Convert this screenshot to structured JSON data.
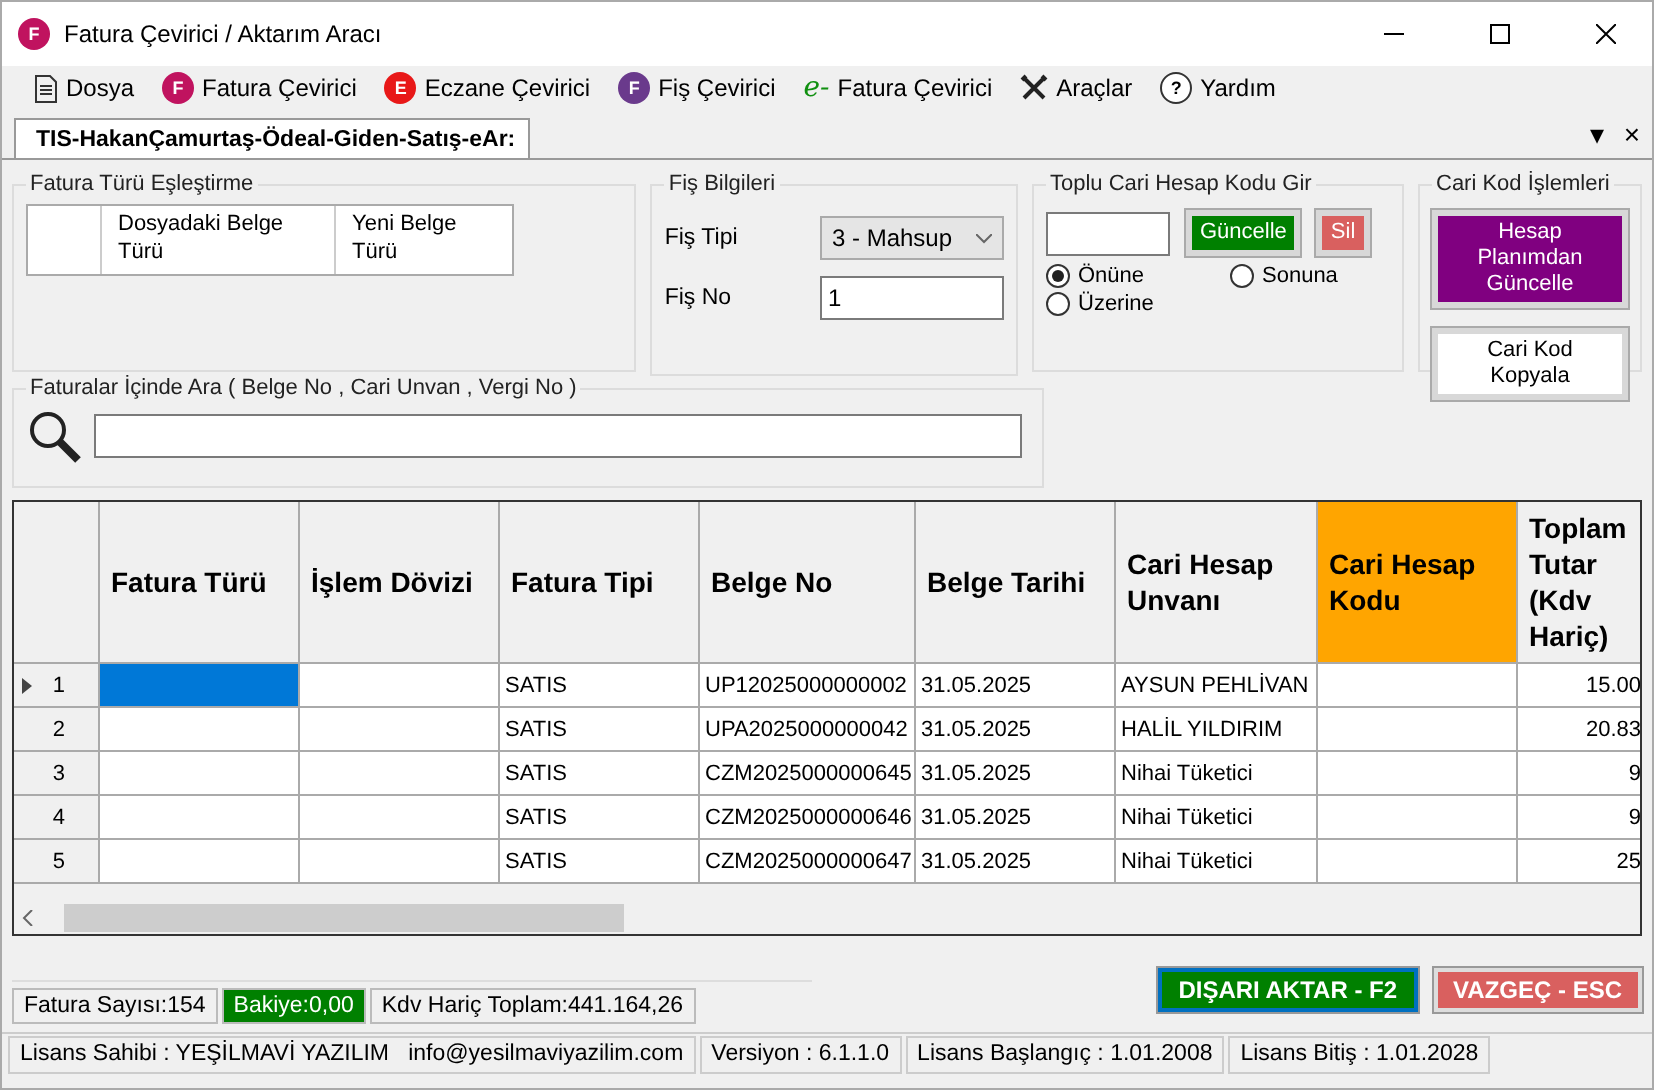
{
  "window": {
    "title": "Fatura Çevirici / Aktarım Aracı",
    "logo": "F"
  },
  "menu": [
    {
      "label": "Dosya",
      "kind": "doc"
    },
    {
      "label": "Fatura Çevirici",
      "kind": "badge",
      "badge": "F",
      "color": "#c0135f"
    },
    {
      "label": "Eczane Çevirici",
      "kind": "badge",
      "badge": "E",
      "color": "#e81818"
    },
    {
      "label": "Fiş Çevirici",
      "kind": "badge",
      "badge": "F",
      "color": "#6a3a8c"
    },
    {
      "label": "Fatura Çevirici",
      "kind": "e",
      "badge": "e-"
    },
    {
      "label": "Araçlar",
      "kind": "tools"
    },
    {
      "label": "Yardım",
      "kind": "help",
      "badge": "?"
    }
  ],
  "tabs": [
    {
      "label": "TIS-HakanÇamurtaş-Ödeal-Giden-Satış-eAr:",
      "selected": true
    }
  ],
  "tab_controls": {
    "dropdown": "▾",
    "close": "×"
  },
  "mapping": {
    "title": "Fatura Türü Eşleştirme",
    "columns": [
      "Dosyadaki Belge Türü",
      "Yeni Belge Türü"
    ]
  },
  "fis": {
    "title": "Fiş Bilgileri",
    "type_label": "Fiş Tipi",
    "type_value": "3 - Mahsup",
    "no_label": "Fiş No",
    "no_value": "1"
  },
  "bulk": {
    "title": "Toplu Cari Hesap Kodu Gir",
    "buttons": [
      {
        "label": "Güncelle",
        "color": "#008000"
      },
      {
        "label": "Sil",
        "color": "#d9605f"
      }
    ],
    "options": [
      {
        "label": "Önüne",
        "selected": true
      },
      {
        "label": "Sonuna",
        "selected": false
      },
      {
        "label": "Üzerine",
        "selected": false
      }
    ]
  },
  "cari": {
    "title": "Cari Kod İşlemleri",
    "buttons": [
      {
        "label": "Hesap Planımdan Güncelle",
        "color": "#800080"
      },
      {
        "label": "Cari Kod Kopyala",
        "color": "#ffffff"
      }
    ]
  },
  "search": {
    "title": "Faturalar İçinde Ara ( Belge No , Cari Unvan , Vergi No )"
  },
  "table": {
    "columns": [
      {
        "label": "Fatura Türü",
        "highlighted": false
      },
      {
        "label": "İşlem Dövizi",
        "highlighted": false
      },
      {
        "label": "Fatura Tipi",
        "highlighted": false
      },
      {
        "label": "Belge No",
        "highlighted": false
      },
      {
        "label": "Belge Tarihi",
        "highlighted": false
      },
      {
        "label": "Cari Hesap Unvanı",
        "highlighted": false
      },
      {
        "label": "Cari Hesap Kodu",
        "highlighted": true
      },
      {
        "label": "Toplam Tutar (Kdv Hariç)",
        "highlighted": false
      }
    ],
    "rows": [
      {
        "n": "1",
        "selected": true,
        "cells": [
          "",
          "",
          "SATIS",
          "UP12025000000002",
          "31.05.2025",
          "AYSUN PEHLİVAN",
          "",
          "15.00"
        ]
      },
      {
        "n": "2",
        "selected": false,
        "cells": [
          "",
          "",
          "SATIS",
          "UPA2025000000042",
          "31.05.2025",
          "HALİL YILDIRIM",
          "",
          "20.83"
        ]
      },
      {
        "n": "3",
        "selected": false,
        "cells": [
          "",
          "",
          "SATIS",
          "CZM2025000000645",
          "31.05.2025",
          "Nihai Tüketici",
          "",
          "9"
        ]
      },
      {
        "n": "4",
        "selected": false,
        "cells": [
          "",
          "",
          "SATIS",
          "CZM2025000000646",
          "31.05.2025",
          "Nihai Tüketici",
          "",
          "9"
        ]
      },
      {
        "n": "5",
        "selected": false,
        "cells": [
          "",
          "",
          "SATIS",
          "CZM2025000000647",
          "31.05.2025",
          "Nihai Tüketici",
          "",
          "25"
        ]
      }
    ]
  },
  "summary": [
    {
      "text": "Fatura Sayısı:154",
      "color": "#f0f0f0"
    },
    {
      "text": "Bakiye:0,00",
      "color": "#008000"
    },
    {
      "text": "Kdv Hariç Toplam:441.164,26",
      "color": "#f0f0f0"
    }
  ],
  "actions": [
    {
      "label": "DIŞARI AKTAR - F2",
      "color": "#008000"
    },
    {
      "label": "VAZGEÇ - ESC",
      "color": "#d9605f"
    }
  ],
  "status_bar": [
    "Lisans Sahibi : YEŞİLMAVİ YAZILIM   info@yesilmaviyazilim.com",
    "Versiyon : 6.1.1.0",
    "Lisans Başlangıç : 1.01.2008",
    "Lisans Bitiş : 1.01.2028"
  ]
}
